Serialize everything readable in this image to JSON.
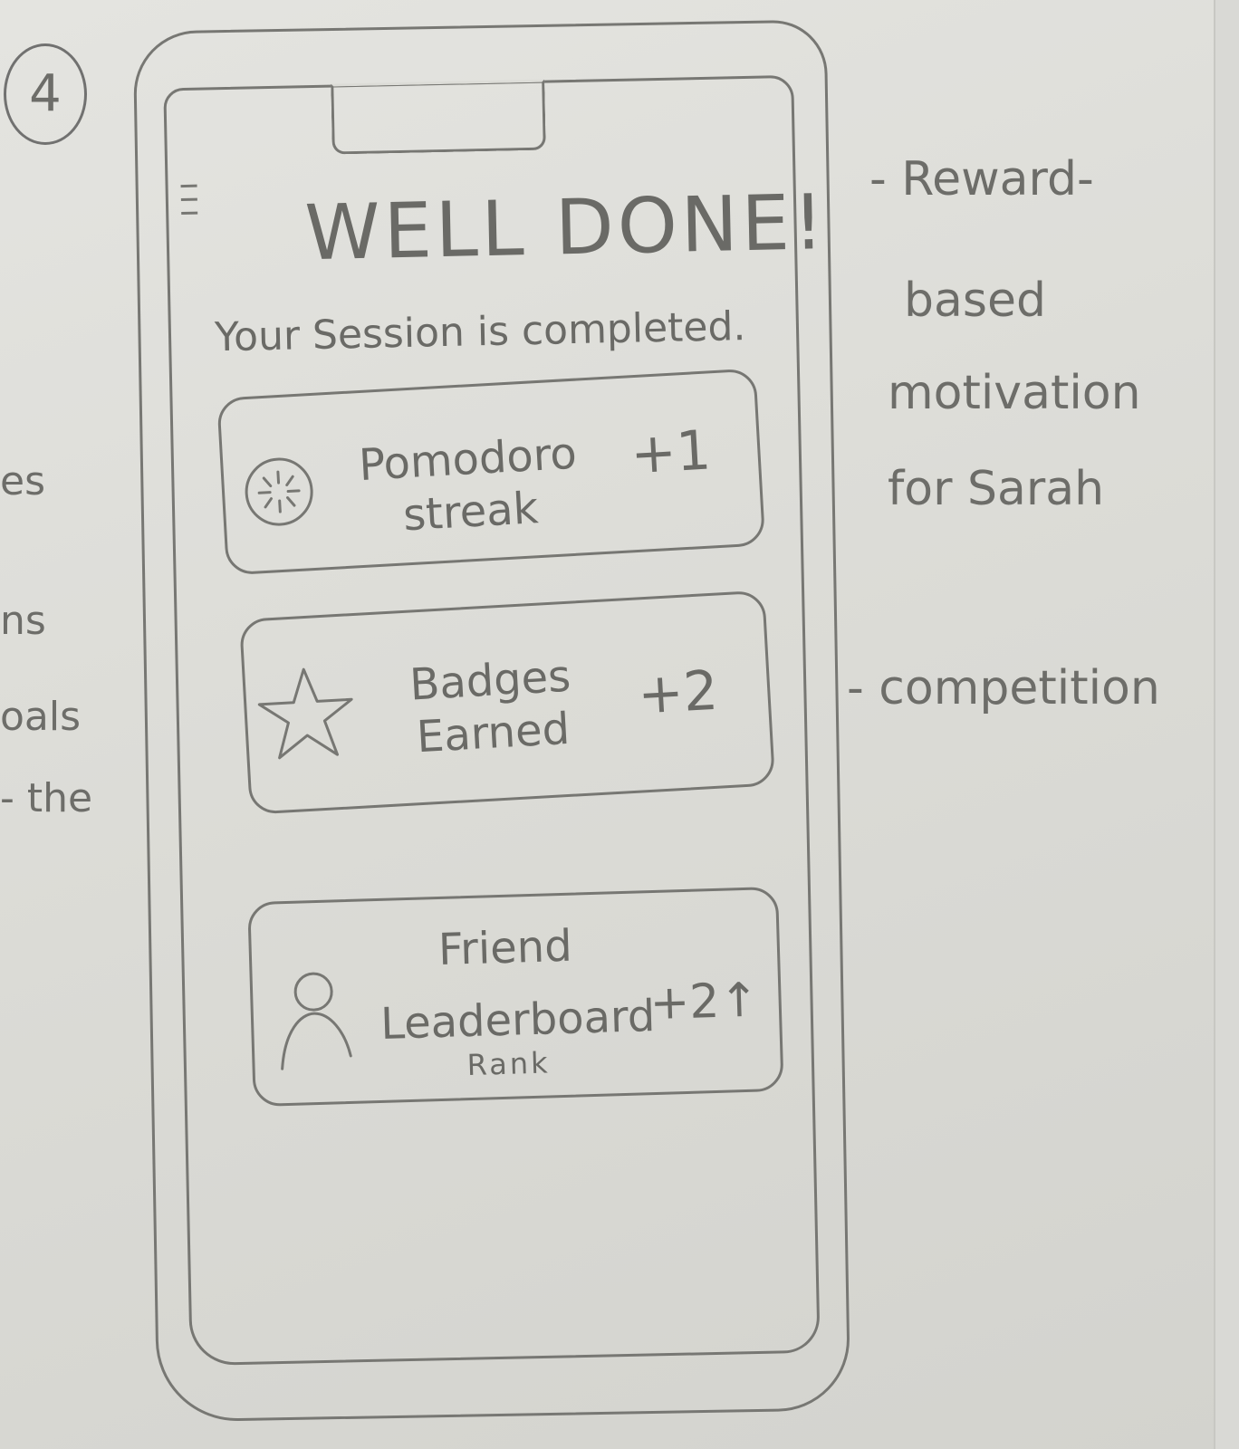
{
  "page_number": "4",
  "margin_notes": [
    "es",
    "ns",
    "oals",
    "- the"
  ],
  "screen": {
    "title": "WELL DONE!",
    "subtitle": "Your Session is completed."
  },
  "cards": [
    {
      "icon": "pomodoro-timer-icon",
      "label_line1": "Pomodoro",
      "label_line2": "streak",
      "value": "+1"
    },
    {
      "icon": "star-icon",
      "label_line1": "Badges",
      "label_line2": "Earned",
      "value": "+2"
    },
    {
      "icon": "person-icon",
      "label_line1": "Friend",
      "label_line2": "Leaderboard",
      "label_line3": "Rank",
      "value": "+2",
      "value_icon": "arrow-up-icon"
    }
  ],
  "annotations": {
    "reward_line1": "- Reward-",
    "reward_line2": "based",
    "reward_line3": "motivation",
    "reward_line4": "for Sarah",
    "competition": "- competition"
  }
}
